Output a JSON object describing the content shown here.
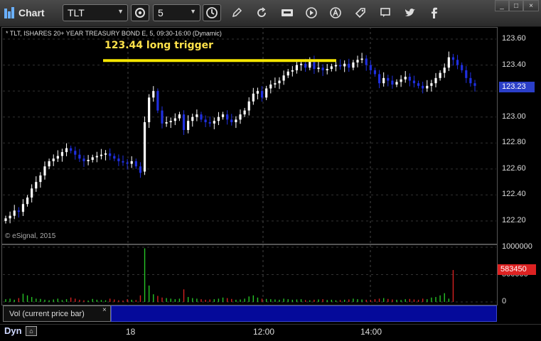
{
  "toolbar": {
    "app_title": "Chart",
    "symbol_value": "TLT",
    "interval_value": "5",
    "icons": [
      "gear-icon",
      "clock-icon",
      "pencil-icon",
      "refresh-icon",
      "get-icon",
      "play-icon",
      "alert-icon",
      "tag-icon",
      "comment-icon",
      "twitter-icon",
      "facebook-icon"
    ]
  },
  "window": {
    "minimize": "_",
    "restore": "□",
    "close": "×"
  },
  "chart": {
    "title": "* TLT, ISHARES 20+ YEAR TREASURY BOND E, 5, 09:30-16:00 (Dynamic)",
    "annotation": "123.44 long trigger",
    "copyright": "© eSignal, 2015",
    "price_axis": [
      "123.60",
      "123.40",
      "123.20",
      "123.00",
      "122.80",
      "122.60",
      "122.40",
      "122.20"
    ],
    "last_price": "123.23",
    "colors": {
      "up": "#ffffff",
      "down": "#1f2fe0",
      "trigger": "#f5e600",
      "volume_up": "#26c426",
      "volume_down": "#d42020"
    }
  },
  "volume": {
    "axis": [
      "1000000",
      "500000",
      "0"
    ],
    "last_value": "583450",
    "study_label": "Vol (current price bar)",
    "study_close": "×"
  },
  "bottom": {
    "mode": "Dyn",
    "lock_icon": "lock-icon",
    "time_labels": [
      "18",
      "12:00",
      "14:00"
    ]
  },
  "chart_data": {
    "type": "candlestick",
    "title": "* TLT, ISHARES 20+ YEAR TREASURY BOND E, 5, 09:30-16:00 (Dynamic)",
    "ylim": [
      122.1,
      123.65
    ],
    "trigger_level": 123.44,
    "closes": [
      122.22,
      122.24,
      122.28,
      122.27,
      122.33,
      122.38,
      122.45,
      122.5,
      122.55,
      122.62,
      122.66,
      122.68,
      122.7,
      122.73,
      122.76,
      122.74,
      122.71,
      122.68,
      122.66,
      122.67,
      122.69,
      122.7,
      122.71,
      122.72,
      122.7,
      122.68,
      122.66,
      122.65,
      122.64,
      122.66,
      122.62,
      122.57,
      122.96,
      123.15,
      123.2,
      123.05,
      122.95,
      122.96,
      122.97,
      122.99,
      123.02,
      122.9,
      122.97,
      123.0,
      123.02,
      122.98,
      122.96,
      122.95,
      122.97,
      123.0,
      123.02,
      122.98,
      122.96,
      122.98,
      123.02,
      123.05,
      123.12,
      123.18,
      123.2,
      123.15,
      123.22,
      123.25,
      123.26,
      123.28,
      123.32,
      123.35,
      123.36,
      123.4,
      123.41,
      123.38,
      123.44,
      123.37,
      123.38,
      123.36,
      123.37,
      123.39,
      123.4,
      123.39,
      123.41,
      123.38,
      123.42,
      123.44,
      123.45,
      123.4,
      123.36,
      123.33,
      123.26,
      123.3,
      123.28,
      123.25,
      123.27,
      123.29,
      123.31,
      123.28,
      123.26,
      123.24,
      123.22,
      123.24,
      123.26,
      123.3,
      123.34,
      123.38,
      123.46,
      123.44,
      123.4,
      123.36,
      123.3,
      123.26,
      123.24
    ],
    "volumes": [
      50000,
      60000,
      40000,
      70000,
      150000,
      120000,
      90000,
      60000,
      55000,
      40000,
      30000,
      45000,
      60000,
      35000,
      50000,
      80000,
      60000,
      40000,
      30000,
      25000,
      55000,
      40000,
      35000,
      30000,
      60000,
      45000,
      30000,
      25000,
      50000,
      40000,
      35000,
      120000,
      980000,
      300000,
      140000,
      110000,
      80000,
      70000,
      60000,
      50000,
      60000,
      230000,
      90000,
      70000,
      60000,
      50000,
      40000,
      45000,
      50000,
      60000,
      80000,
      70000,
      55000,
      40000,
      45000,
      60000,
      100000,
      120000,
      80000,
      60000,
      55000,
      50000,
      45000,
      40000,
      60000,
      50000,
      40000,
      45000,
      50000,
      35000,
      30000,
      40000,
      45000,
      50000,
      35000,
      40000,
      30000,
      35000,
      40000,
      45000,
      60000,
      50000,
      45000,
      40000,
      35000,
      50000,
      60000,
      70000,
      55000,
      45000,
      40000,
      35000,
      50000,
      55000,
      45000,
      40000,
      60000,
      50000,
      80000,
      90000,
      120000,
      160000,
      60000,
      583450
    ]
  }
}
